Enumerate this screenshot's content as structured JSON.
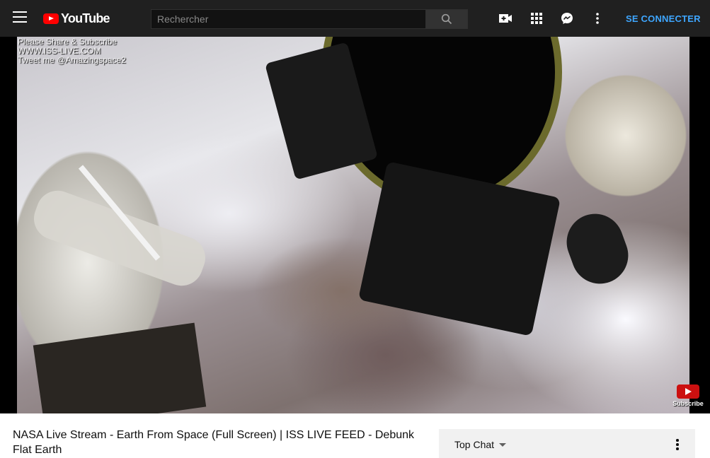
{
  "header": {
    "logo_text": "YouTube",
    "search": {
      "placeholder": "Rechercher",
      "value": ""
    },
    "icons": [
      "menu-icon",
      "search-icon",
      "create-video-icon",
      "apps-grid-icon",
      "messages-icon",
      "more-vert-icon"
    ],
    "signin_label": "SE CONNECTER",
    "colors": {
      "bar": "#202020",
      "accent": "#3ea6ff",
      "logo_red": "#ff0000"
    }
  },
  "player": {
    "overlay_lines": [
      "Please Share & Subscribe",
      "WWW.ISS-LIVE.COM",
      "Tweet me @Amazingspace2"
    ],
    "watermark_label": "Subscribe"
  },
  "video": {
    "title": "NASA Live Stream - Earth From Space (Full Screen) | ISS LIVE FEED - Debunk Flat Earth"
  },
  "chat": {
    "mode_label": "Top Chat"
  }
}
